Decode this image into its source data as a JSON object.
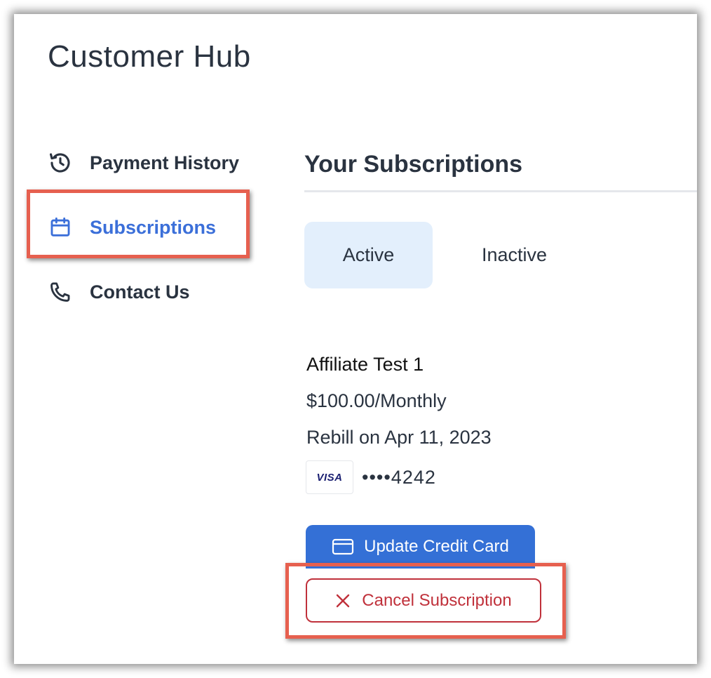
{
  "app": {
    "title": "Customer Hub"
  },
  "sidebar": {
    "items": [
      {
        "label": "Payment History",
        "icon": "history-icon",
        "active": false
      },
      {
        "label": "Subscriptions",
        "icon": "calendar-icon",
        "active": true
      },
      {
        "label": "Contact Us",
        "icon": "phone-icon",
        "active": false
      }
    ]
  },
  "main": {
    "section_title": "Your Subscriptions",
    "tabs": [
      {
        "label": "Active",
        "selected": true
      },
      {
        "label": "Inactive",
        "selected": false
      }
    ],
    "subscription": {
      "name": "Affiliate Test 1",
      "price": "$100.00/Monthly",
      "rebill": "Rebill on Apr 11, 2023",
      "card_brand": "VISA",
      "card_number": "••••4242"
    },
    "buttons": {
      "update_card": "Update Credit Card",
      "cancel_subscription": "Cancel Subscription"
    }
  },
  "colors": {
    "accent": "#3b6fd9",
    "primary_button": "#3470d6",
    "danger": "#c0313b",
    "tab_active_bg": "#e3effc",
    "highlight": "#e6604f"
  }
}
